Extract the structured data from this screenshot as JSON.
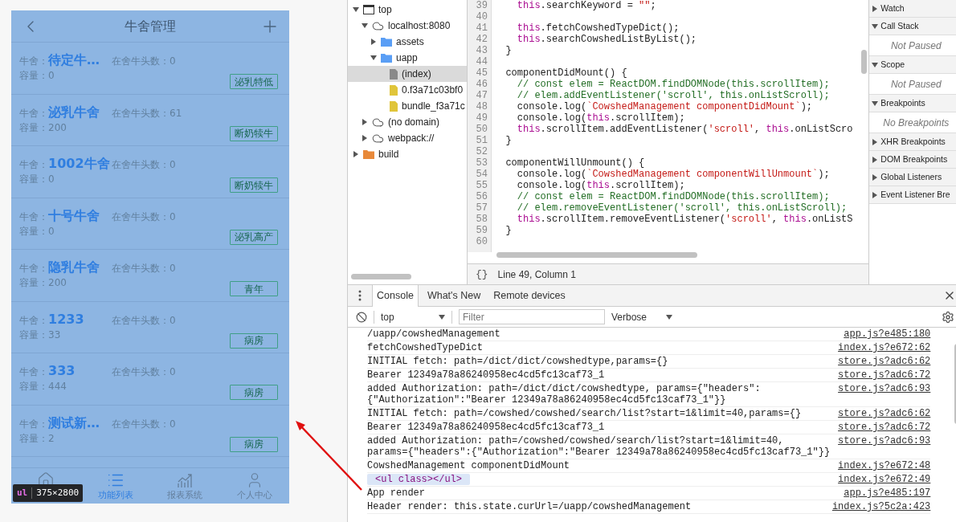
{
  "phone": {
    "title": "牛舍管理",
    "cowsheds": [
      {
        "shed_label": "牛舍：",
        "name": "待定牛…",
        "count_text": "在舍牛头数：0",
        "capacity_text": "容量：0",
        "tag": "泌乳特低"
      },
      {
        "shed_label": "牛舍：",
        "name": "泌乳牛舍",
        "count_text": "在舍牛头数：61",
        "capacity_text": "容量：200",
        "tag": "断奶犊牛"
      },
      {
        "shed_label": "牛舍：",
        "name": "1002牛舍",
        "count_text": "在舍牛头数：0",
        "capacity_text": "容量：0",
        "tag": "断奶犊牛"
      },
      {
        "shed_label": "牛舍：",
        "name": "十号牛舍",
        "count_text": "在舍牛头数：0",
        "capacity_text": "容量：0",
        "tag": "泌乳高产"
      },
      {
        "shed_label": "牛舍：",
        "name": "隐乳牛舍",
        "count_text": "在舍牛头数：0",
        "capacity_text": "容量：200",
        "tag": "青年"
      },
      {
        "shed_label": "牛舍：",
        "name": "1233",
        "count_text": "在舍牛头数：0",
        "capacity_text": "容量：33",
        "tag": "病房"
      },
      {
        "shed_label": "牛舍：",
        "name": "333",
        "count_text": "在舍牛头数：0",
        "capacity_text": "容量：444",
        "tag": "病房"
      },
      {
        "shed_label": "牛舍：",
        "name": "测试新…",
        "count_text": "在舍牛头数：0",
        "capacity_text": "容量：2",
        "tag": "病房"
      }
    ],
    "tabs": [
      {
        "kind": "home",
        "selected": false
      },
      {
        "kind": "list",
        "label": "功能列表",
        "selected": true
      },
      {
        "kind": "chart",
        "label": "报表系统",
        "selected": false
      },
      {
        "kind": "user",
        "label": "个人中心",
        "selected": false
      }
    ],
    "inspect_tooltip": {
      "tag": "ul",
      "size": "375×2800"
    }
  },
  "devtools": {
    "file_tree": [
      {
        "kind": "frame",
        "label": "top",
        "expanded": true,
        "selected": false,
        "children": [
          {
            "kind": "domain",
            "label": "localhost:8080",
            "expanded": true,
            "selected": false,
            "children": [
              {
                "kind": "folder",
                "label": "assets",
                "expanded": false,
                "selected": false,
                "color": "#5a9ef5"
              },
              {
                "kind": "folder",
                "label": "uapp",
                "expanded": true,
                "selected": false,
                "color": "#5a9ef5",
                "children": [
                  {
                    "kind": "file",
                    "label": "(index)",
                    "selected": true,
                    "color": "#8a8a8a"
                  },
                  {
                    "kind": "file",
                    "label": "0.f3a71c03bf0",
                    "selected": false,
                    "color": "#e0c53a"
                  },
                  {
                    "kind": "file",
                    "label": "bundle_f3a71c",
                    "selected": false,
                    "color": "#e0c53a"
                  }
                ]
              }
            ]
          },
          {
            "kind": "domain",
            "label": "(no domain)",
            "expanded": false,
            "selected": false
          },
          {
            "kind": "domain",
            "label": "webpack://",
            "expanded": false,
            "selected": false
          }
        ]
      },
      {
        "kind": "folder",
        "label": "build",
        "expanded": false,
        "selected": false,
        "color": "#e8893a"
      }
    ],
    "code_lines": [
      {
        "number": "39",
        "tokens": [
          {
            "kind": "keyword",
            "text": "    this"
          },
          {
            "kind": "plain",
            "text": ".searchKeyword = "
          },
          {
            "kind": "string",
            "text": "\"\""
          },
          {
            "kind": "plain",
            "text": ";"
          }
        ]
      },
      {
        "number": "40"
      },
      {
        "number": "41",
        "tokens": [
          {
            "kind": "keyword",
            "text": "    this"
          },
          {
            "kind": "plain",
            "text": ".fetchCowshedTypeDict();"
          }
        ]
      },
      {
        "number": "42",
        "tokens": [
          {
            "kind": "keyword",
            "text": "    this"
          },
          {
            "kind": "plain",
            "text": ".searchCowshedListByList();"
          }
        ]
      },
      {
        "number": "43",
        "tokens": [
          {
            "kind": "plain",
            "text": "  }"
          }
        ]
      },
      {
        "number": "44"
      },
      {
        "number": "45",
        "tokens": [
          {
            "kind": "plain",
            "text": "  componentDidMount() {"
          }
        ]
      },
      {
        "number": "46",
        "tokens": [
          {
            "kind": "comment",
            "text": "    // const elem = ReactDOM.findDOMNode(this.scrollItem);"
          }
        ]
      },
      {
        "number": "47",
        "tokens": [
          {
            "kind": "comment",
            "text": "    // elem.addEventListener('scroll', this.onListScroll);"
          }
        ]
      },
      {
        "number": "48",
        "tokens": [
          {
            "kind": "plain",
            "text": "    console.log("
          },
          {
            "kind": "string",
            "text": "`CowshedManagement componentDidMount`"
          },
          {
            "kind": "plain",
            "text": ");"
          }
        ]
      },
      {
        "number": "49",
        "tokens": [
          {
            "kind": "plain",
            "text": "    console.log("
          },
          {
            "kind": "keyword",
            "text": "this"
          },
          {
            "kind": "plain",
            "text": ".scrollItem);"
          }
        ]
      },
      {
        "number": "50",
        "tokens": [
          {
            "kind": "keyword",
            "text": "    this"
          },
          {
            "kind": "plain",
            "text": ".scrollItem.addEventListener("
          },
          {
            "kind": "string",
            "text": "'scroll'"
          },
          {
            "kind": "plain",
            "text": ", "
          },
          {
            "kind": "keyword",
            "text": "this"
          },
          {
            "kind": "plain",
            "text": ".onListScro"
          }
        ]
      },
      {
        "number": "51",
        "tokens": [
          {
            "kind": "plain",
            "text": "  }"
          }
        ]
      },
      {
        "number": "52"
      },
      {
        "number": "53",
        "tokens": [
          {
            "kind": "plain",
            "text": "  componentWillUnmount() {"
          }
        ]
      },
      {
        "number": "54",
        "tokens": [
          {
            "kind": "plain",
            "text": "    console.log("
          },
          {
            "kind": "string",
            "text": "`CowshedManagement componentWillUnmount`"
          },
          {
            "kind": "plain",
            "text": ");"
          }
        ]
      },
      {
        "number": "55",
        "tokens": [
          {
            "kind": "plain",
            "text": "    console.log("
          },
          {
            "kind": "keyword",
            "text": "this"
          },
          {
            "kind": "plain",
            "text": ".scrollItem);"
          }
        ]
      },
      {
        "number": "56",
        "tokens": [
          {
            "kind": "comment",
            "text": "    // const elem = ReactDOM.findDOMNode(this.scrollItem);"
          }
        ]
      },
      {
        "number": "57",
        "tokens": [
          {
            "kind": "comment",
            "text": "    // elem.removeEventListener('scroll', this.onListScroll);"
          }
        ]
      },
      {
        "number": "58",
        "tokens": [
          {
            "kind": "keyword",
            "text": "    this"
          },
          {
            "kind": "plain",
            "text": ".scrollItem.removeEventListener("
          },
          {
            "kind": "string",
            "text": "'scroll'"
          },
          {
            "kind": "plain",
            "text": ", "
          },
          {
            "kind": "keyword",
            "text": "this"
          },
          {
            "kind": "plain",
            "text": ".onListS"
          }
        ]
      },
      {
        "number": "59",
        "tokens": [
          {
            "kind": "plain",
            "text": "  }"
          }
        ]
      },
      {
        "number": "60"
      }
    ],
    "status_bar": {
      "format_button": "{}",
      "position": "Line 49, Column 1"
    },
    "sidebar": [
      {
        "label": "Watch",
        "expanded": false
      },
      {
        "label": "Call Stack",
        "expanded": true,
        "body": "Not Paused"
      },
      {
        "label": "Scope",
        "expanded": true,
        "body": "Not Paused"
      },
      {
        "label": "Breakpoints",
        "expanded": true,
        "body": "No Breakpoints"
      },
      {
        "label": "XHR Breakpoints",
        "expanded": false
      },
      {
        "label": "DOM Breakpoints",
        "expanded": false
      },
      {
        "label": "Global Listeners",
        "expanded": false
      },
      {
        "label": "Event Listener Bre",
        "expanded": false
      }
    ],
    "drawer_tabs": [
      {
        "label": "Console",
        "selected": true
      },
      {
        "label": "What's New",
        "selected": false
      },
      {
        "label": "Remote devices",
        "selected": false
      }
    ],
    "console_toolbar": {
      "context": "top",
      "filter_placeholder": "Filter",
      "level": "Verbose"
    },
    "messages": [
      {
        "kind": "log",
        "text": "/uapp/cowshedManagement",
        "source": "app.js?e485:180"
      },
      {
        "kind": "log",
        "text": "fetchCowshedTypeDict",
        "source": "index.js?e672:62"
      },
      {
        "kind": "log",
        "text": "INITIAL fetch: path=/dict/dict/cowshedtype,params={}",
        "source": "store.js?adc6:62"
      },
      {
        "kind": "log",
        "text": "Bearer 12349a78a86240958ec4cd5fc13caf73_1",
        "source": "store.js?adc6:72"
      },
      {
        "kind": "log",
        "text": "added Authorization: path=/dict/dict/cowshedtype, params={\"headers\":\n{\"Authorization\":\"Bearer 12349a78a86240958ec4cd5fc13caf73_1\"}}",
        "source": "store.js?adc6:93"
      },
      {
        "kind": "log",
        "text": "INITIAL fetch: path=/cowshed/cowshed/search/list?start=1&limit=40,params={}",
        "source": "store.js?adc6:62"
      },
      {
        "kind": "log",
        "text": "Bearer 12349a78a86240958ec4cd5fc13caf73_1",
        "source": "store.js?adc6:72"
      },
      {
        "kind": "log",
        "text": "added Authorization: path=/cowshed/cowshed/search/list?start=1&limit=40,\nparams={\"headers\":{\"Authorization\":\"Bearer 12349a78a86240958ec4cd5fc13caf73_1\"}}",
        "source": "store.js?adc6:93"
      },
      {
        "kind": "log",
        "text": "CowshedManagement componentDidMount",
        "source": "index.js?e672:48"
      },
      {
        "kind": "element",
        "text": "<ul class></ul>",
        "source": "index.js?e672:49"
      },
      {
        "kind": "log",
        "text": "App render",
        "source": "app.js?e485:197"
      },
      {
        "kind": "log",
        "text": "Header render: this.state.curUrl=/uapp/cowshedManagement",
        "source": "index.js?5c2a:423"
      }
    ]
  }
}
